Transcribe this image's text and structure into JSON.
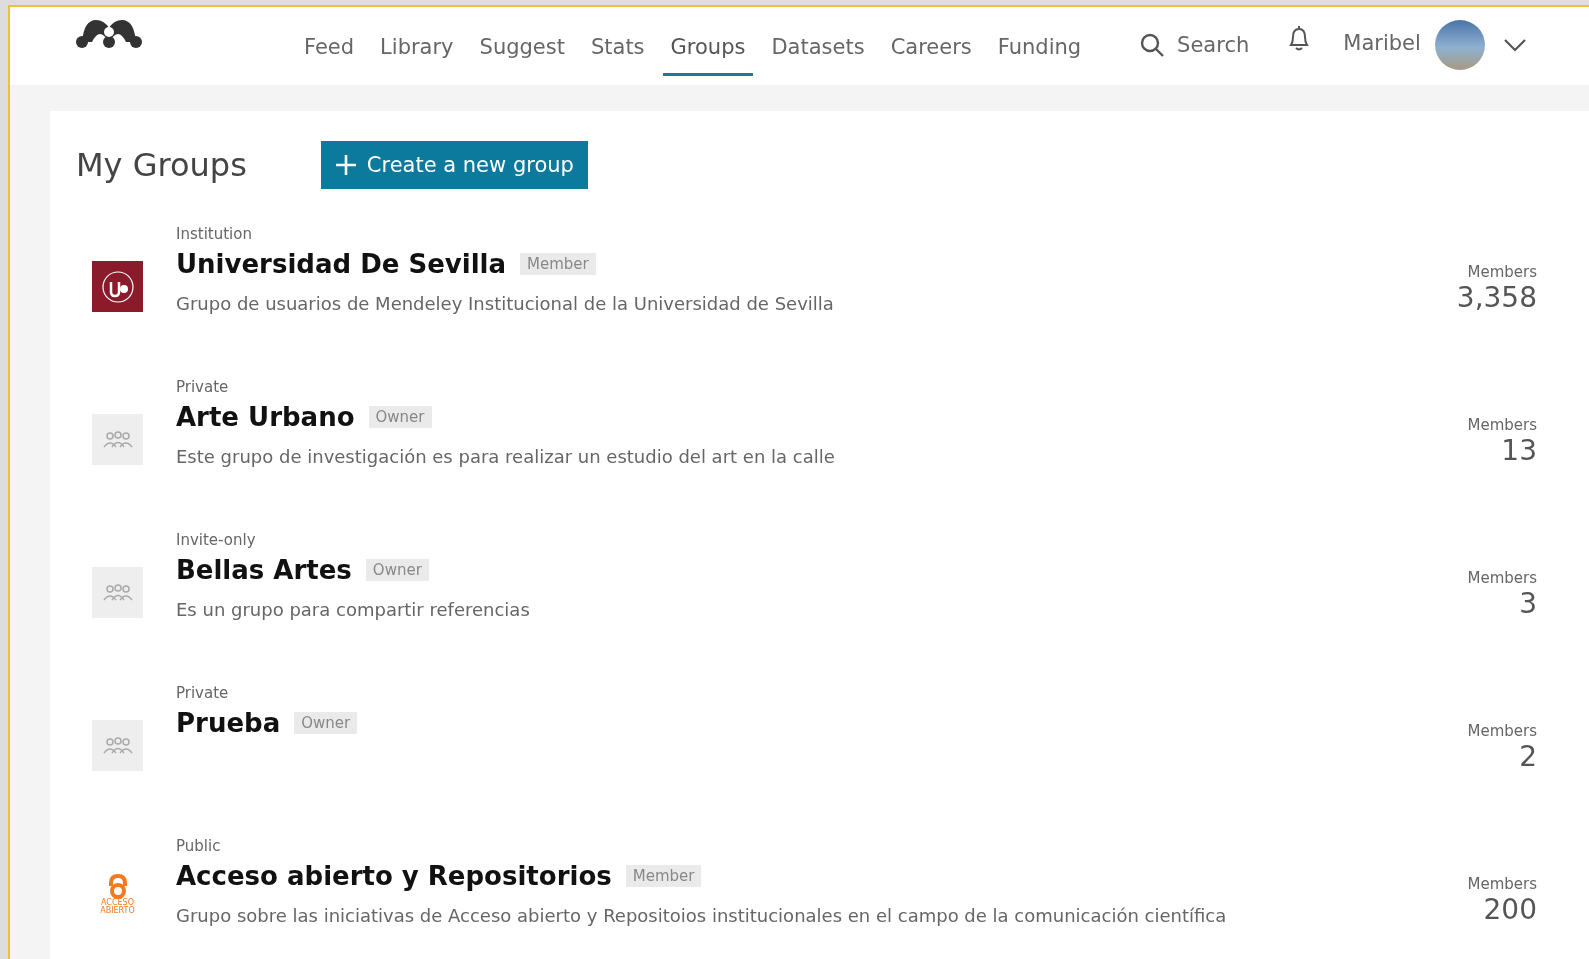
{
  "nav": {
    "items": [
      {
        "label": "Feed",
        "selected": false
      },
      {
        "label": "Library",
        "selected": false
      },
      {
        "label": "Suggest",
        "selected": false
      },
      {
        "label": "Stats",
        "selected": false
      },
      {
        "label": "Groups",
        "selected": true
      },
      {
        "label": "Datasets",
        "selected": false
      },
      {
        "label": "Careers",
        "selected": false
      },
      {
        "label": "Funding",
        "selected": false
      }
    ],
    "search": "Search",
    "user": "Maribel"
  },
  "page": {
    "title": "My Groups",
    "create_button": "Create a new group"
  },
  "groups": [
    {
      "type": "Institution",
      "name": "Universidad De Sevilla",
      "role": "Member",
      "description": "Grupo de usuarios de Mendeley Institucional de la Universidad de Sevilla",
      "members_label": "Members",
      "members": "3,358",
      "kind": "seal"
    },
    {
      "type": "Private",
      "name": "Arte Urbano",
      "role": "Owner",
      "description": "Este grupo de investigación es para realizar un estudio del art en la calle",
      "members_label": "Members",
      "members": "13",
      "kind": "placeholder"
    },
    {
      "type": "Invite-only",
      "name": "Bellas Artes",
      "role": "Owner",
      "description": "Es un grupo para compartir referencias",
      "members_label": "Members",
      "members": "3",
      "kind": "placeholder"
    },
    {
      "type": "Private",
      "name": "Prueba",
      "role": "Owner",
      "members_label": "Members",
      "members": "2",
      "kind": "placeholder"
    },
    {
      "type": "Public",
      "name": "Acceso abierto y Repositorios",
      "role": "Member",
      "description": "Grupo sobre las iniciativas de Acceso abierto y Repositoios institucionales en el campo de la comunicación científica",
      "members_label": "Members",
      "members": "200",
      "kind": "lock",
      "logo_text": "ACCESO ABIERTO"
    }
  ]
}
